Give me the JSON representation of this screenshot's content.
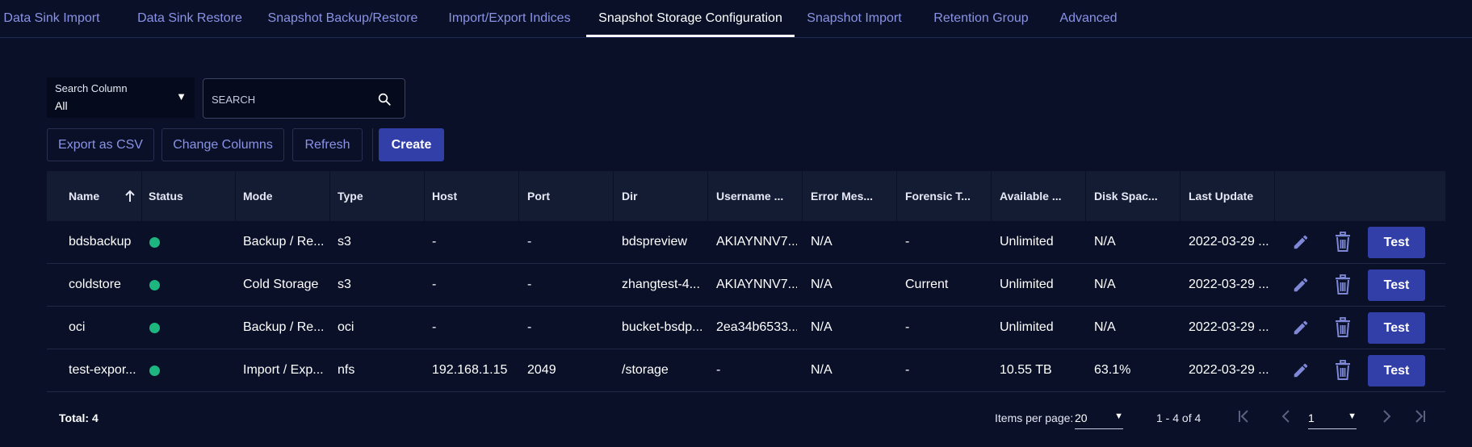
{
  "tabs": [
    {
      "label": "Data Sink Import",
      "active": false
    },
    {
      "label": "Data Sink Restore",
      "active": false
    },
    {
      "label": "Snapshot Backup/Restore",
      "active": false
    },
    {
      "label": "Import/Export Indices",
      "active": false
    },
    {
      "label": "Snapshot Storage Configuration",
      "active": true
    },
    {
      "label": "Snapshot Import",
      "active": false
    },
    {
      "label": "Retention Group",
      "active": false
    },
    {
      "label": "Advanced",
      "active": false
    }
  ],
  "search": {
    "column_label": "Search Column",
    "column_value": "All",
    "placeholder": "SEARCH"
  },
  "toolbar": {
    "export_label": "Export as CSV",
    "columns_label": "Change Columns",
    "refresh_label": "Refresh",
    "create_label": "Create"
  },
  "table": {
    "columns": [
      "Name",
      "Status",
      "Mode",
      "Type",
      "Host",
      "Port",
      "Dir",
      "Username ...",
      "Error Mes...",
      "Forensic T...",
      "Available ...",
      "Disk Spac...",
      "Last Update"
    ],
    "sort_column": "Name",
    "rows": [
      {
        "name": "bdsbackup",
        "status": "green",
        "mode": "Backup / Re...",
        "type": "s3",
        "host": "-",
        "port": "-",
        "dir": "bdspreview",
        "username": "AKIAYNNV7...",
        "error": "N/A",
        "forensic": "-",
        "available": "Unlimited",
        "disk": "N/A",
        "last_update": "2022-03-29 ...",
        "test_label": "Test"
      },
      {
        "name": "coldstore",
        "status": "green",
        "mode": "Cold Storage",
        "type": "s3",
        "host": "-",
        "port": "-",
        "dir": "zhangtest-4...",
        "username": "AKIAYNNV7...",
        "error": "N/A",
        "forensic": "Current",
        "available": "Unlimited",
        "disk": "N/A",
        "last_update": "2022-03-29 ...",
        "test_label": "Test"
      },
      {
        "name": "oci",
        "status": "green",
        "mode": "Backup / Re...",
        "type": "oci",
        "host": "-",
        "port": "-",
        "dir": "bucket-bsdp...",
        "username": "2ea34b6533...",
        "error": "N/A",
        "forensic": "-",
        "available": "Unlimited",
        "disk": "N/A",
        "last_update": "2022-03-29 ...",
        "test_label": "Test"
      },
      {
        "name": "test-expor...",
        "status": "green",
        "mode": "Import / Exp...",
        "type": "nfs",
        "host": "192.168.1.15",
        "port": "2049",
        "dir": "/storage",
        "username": "-",
        "error": "N/A",
        "forensic": "-",
        "available": "10.55 TB",
        "disk": "63.1%",
        "last_update": "2022-03-29 ...",
        "test_label": "Test"
      }
    ]
  },
  "footer": {
    "total": "Total: 4",
    "items_per_page_label": "Items per page:",
    "items_per_page": "20",
    "range": "1 - 4 of 4",
    "page": "1"
  },
  "colors": {
    "background": "#0a1028",
    "accent": "#333fa8",
    "tab_text": "#8a93e6",
    "status_ok": "#1db67e"
  }
}
